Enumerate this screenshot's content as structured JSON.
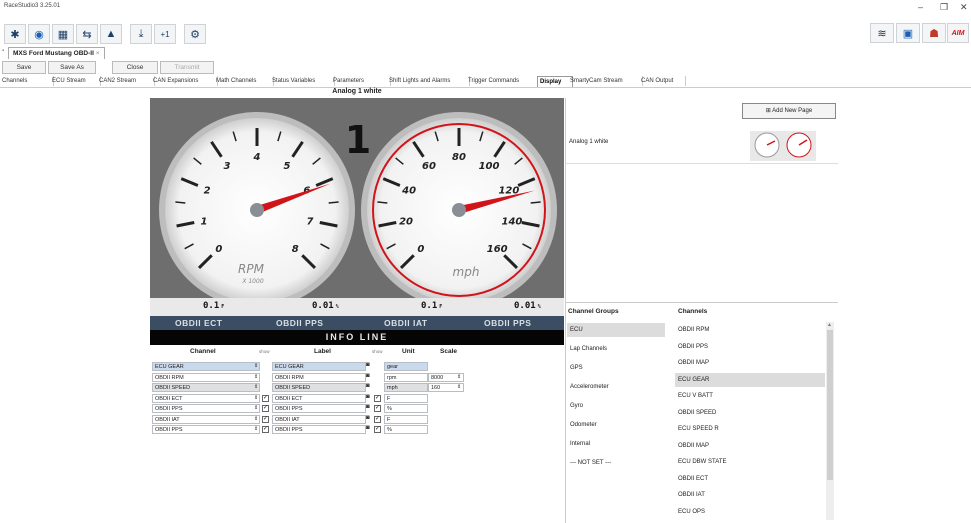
{
  "window": {
    "title": "RaceStudio3 3.25.01",
    "controls": [
      "–",
      "❐",
      "✕"
    ]
  },
  "toolbar": {
    "left_icons": [
      "wrench-icon",
      "gauge-icon",
      "grid-icon",
      "transfer-icon",
      "car-icon",
      "download-icon",
      "plus-one-icon",
      "settings-icon"
    ],
    "left_glyphs": [
      "✱",
      "◉",
      "▦",
      "⇆",
      "▲",
      "⤓",
      "+1",
      "⚙"
    ],
    "right_icons": [
      "wifi-icon",
      "device-icon",
      "user-icon",
      "aim-logo"
    ],
    "right_glyphs": [
      "≋",
      "▣",
      "☗",
      "AIM"
    ]
  },
  "file_tab": {
    "label": "MXS Ford Mustang OBD-II",
    "close": "×"
  },
  "actions": {
    "save": "Save",
    "save_as": "Save As",
    "close": "Close",
    "transmit": "Transmit"
  },
  "tabs": [
    "Channels",
    "ECU Stream",
    "CAN2 Stream",
    "CAN Expansions",
    "Math Channels",
    "Status Variables",
    "Parameters",
    "Shift Lights and Alarms",
    "Trigger Commands",
    "Display",
    "SmartyCam Stream",
    "CAN Output"
  ],
  "active_tab": "Display",
  "page_title": "Analog 1 white",
  "dash": {
    "gear": "1",
    "rpm_ticks": [
      "0",
      "1",
      "2",
      "3",
      "4",
      "5",
      "6",
      "7",
      "8"
    ],
    "rpm_unit": "RPM",
    "rpm_mult": "X 1000",
    "rpm_value_fraction": 0.76,
    "mph_ticks": [
      "0",
      "20",
      "40",
      "60",
      "80",
      "100",
      "120",
      "140",
      "160"
    ],
    "mph_unit": "mph",
    "mph_value_fraction": 0.78,
    "values": [
      "0.1",
      "0.01",
      "0.1",
      "0.01"
    ],
    "value_units": [
      "F",
      "%",
      "F",
      "%"
    ],
    "channels": [
      "OBDII ECT",
      "OBDII PPS",
      "OBDII IAT",
      "OBDII PPS"
    ],
    "info_line": "INFO LINE"
  },
  "table": {
    "headers": {
      "channel": "Channel",
      "show1": "show",
      "label": "Label",
      "show2": "show",
      "unit": "Unit",
      "scale": "Scale"
    },
    "rows": [
      {
        "channel": "ECU GEAR",
        "label": "ECU GEAR",
        "unit": "gear",
        "scale": "",
        "checked": false
      },
      {
        "channel": "OBDII RPM",
        "label": "OBDII RPM",
        "unit": "rpm",
        "scale": "8000",
        "checked": false
      },
      {
        "channel": "OBDII SPEED",
        "label": "OBDII SPEED",
        "unit": "mph",
        "scale": "160",
        "checked": false
      },
      {
        "channel": "OBDII ECT",
        "label": "OBDII ECT",
        "unit": "F",
        "scale": "",
        "checked": true
      },
      {
        "channel": "OBDII PPS",
        "label": "OBDII PPS",
        "unit": "%",
        "scale": "",
        "checked": true
      },
      {
        "channel": "OBDII IAT",
        "label": "OBDII IAT",
        "unit": "F",
        "scale": "",
        "checked": true
      },
      {
        "channel": "OBDII PPS",
        "label": "OBDII PPS",
        "unit": "%",
        "scale": "",
        "checked": true
      }
    ]
  },
  "right_panel": {
    "add_page": "Add New Page",
    "page_name": "Analog 1 white",
    "groups_header": "Channel Groups",
    "channels_header": "Channels",
    "groups": [
      "ECU",
      "Lap Channels",
      "GPS",
      "Accelerometer",
      "Gyro",
      "Odometer",
      "Internal",
      "--- NOT SET ---"
    ],
    "selected_group": "ECU",
    "channels": [
      "OBDII RPM",
      "OBDII PPS",
      "OBDII MAP",
      "ECU GEAR",
      "ECU V BATT",
      "OBDII SPEED",
      "ECU SPEED R",
      "OBDII MAP",
      "ECU DBW STATE",
      "OBDII ECT",
      "OBDII IAT",
      "ECU OPS"
    ],
    "selected_channel": "ECU GEAR"
  },
  "colors": {
    "needle": "#d0141a",
    "panel": "#6e6e6e",
    "channel_bar": "#3b4d63",
    "highlight": "#c9d9ee"
  }
}
